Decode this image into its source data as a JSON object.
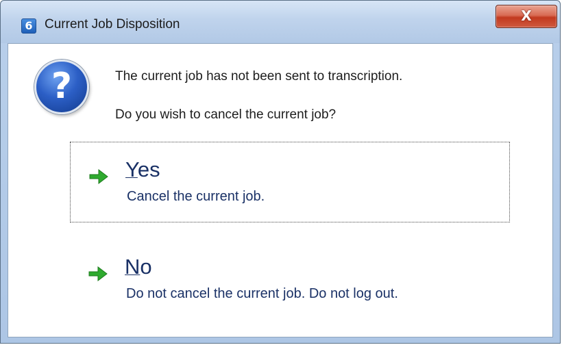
{
  "window": {
    "title": "Current Job Disposition",
    "app_icon_glyph": "6",
    "close_glyph": "X"
  },
  "dialog": {
    "icon": "question-icon",
    "icon_glyph": "?",
    "message_primary": "The current job has not been sent to transcription.",
    "message_secondary": "Do you wish to cancel the current job?"
  },
  "options": [
    {
      "mnemonic": "Y",
      "label_rest": "es",
      "description": "Cancel the current job.",
      "focused": true,
      "icon": "green-arrow-icon"
    },
    {
      "mnemonic": "N",
      "label_rest": "o",
      "description": "Do not cancel the current job. Do not log out.",
      "focused": false,
      "icon": "green-arrow-icon"
    }
  ],
  "colors": {
    "command_text": "#1a3166",
    "arrow": "#2faa2f",
    "close_button": "#c2391f",
    "question_icon": "#2c5fc6"
  }
}
